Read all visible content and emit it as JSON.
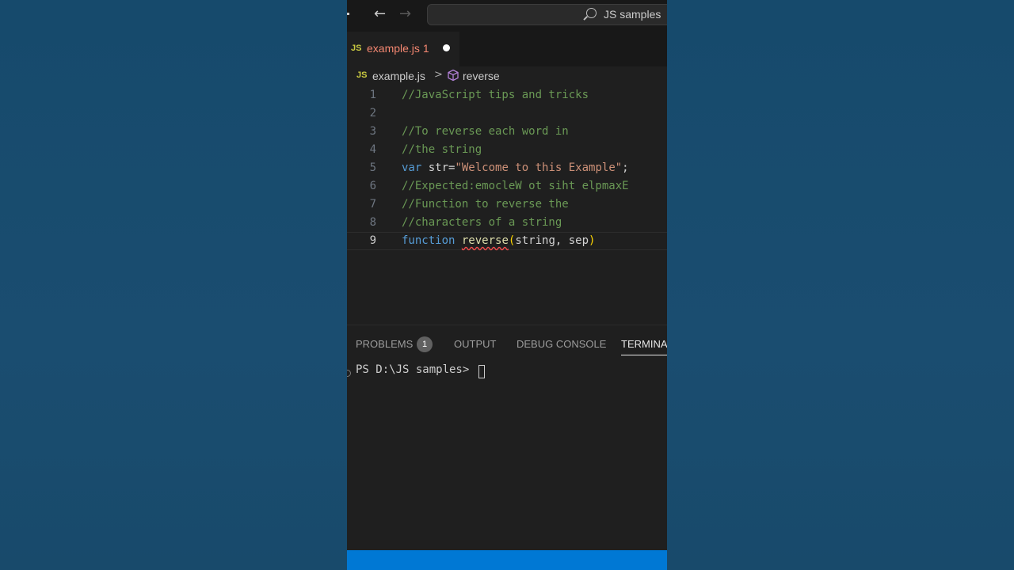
{
  "titlebar": {
    "search_text": "JS samples",
    "back_icon": "arrow-left-icon",
    "forward_icon": "arrow-right-icon"
  },
  "tab": {
    "badge": "JS",
    "filename": "example.js",
    "problem_count": "1"
  },
  "breadcrumb": {
    "badge": "JS",
    "file": "example.js",
    "separator": ">",
    "symbol": "reverse"
  },
  "editor": {
    "lines": [
      {
        "num": "1",
        "text": "//JavaScript tips and tricks"
      },
      {
        "num": "2",
        "text": ""
      },
      {
        "num": "3",
        "text": "//To reverse each word in"
      },
      {
        "num": "4",
        "text": "//the string"
      },
      {
        "num": "5",
        "kw": "var",
        "name": "str=",
        "str": "\"Welcome to this Example\"",
        "tail": ";"
      },
      {
        "num": "6",
        "text": "//Expected:emocleW ot siht elpmaxE"
      },
      {
        "num": "7",
        "text": "//Function to reverse the"
      },
      {
        "num": "8",
        "text": "//characters of a string"
      },
      {
        "num": "9",
        "kw": "function",
        "fn": "reverse",
        "open": "(",
        "params": "string, sep",
        "close": ")"
      }
    ]
  },
  "panel": {
    "tabs": [
      "PROBLEMS",
      "OUTPUT",
      "DEBUG CONSOLE",
      "TERMINAL"
    ],
    "problems_badge": "1",
    "terminal_prompt": "PS D:\\JS samples> "
  },
  "colors": {
    "accent": "#0078d4",
    "comment": "#6a9955",
    "keyword": "#569cd6",
    "string": "#ce9178",
    "function": "#dcdcaa",
    "modified_tab": "#f48771"
  }
}
